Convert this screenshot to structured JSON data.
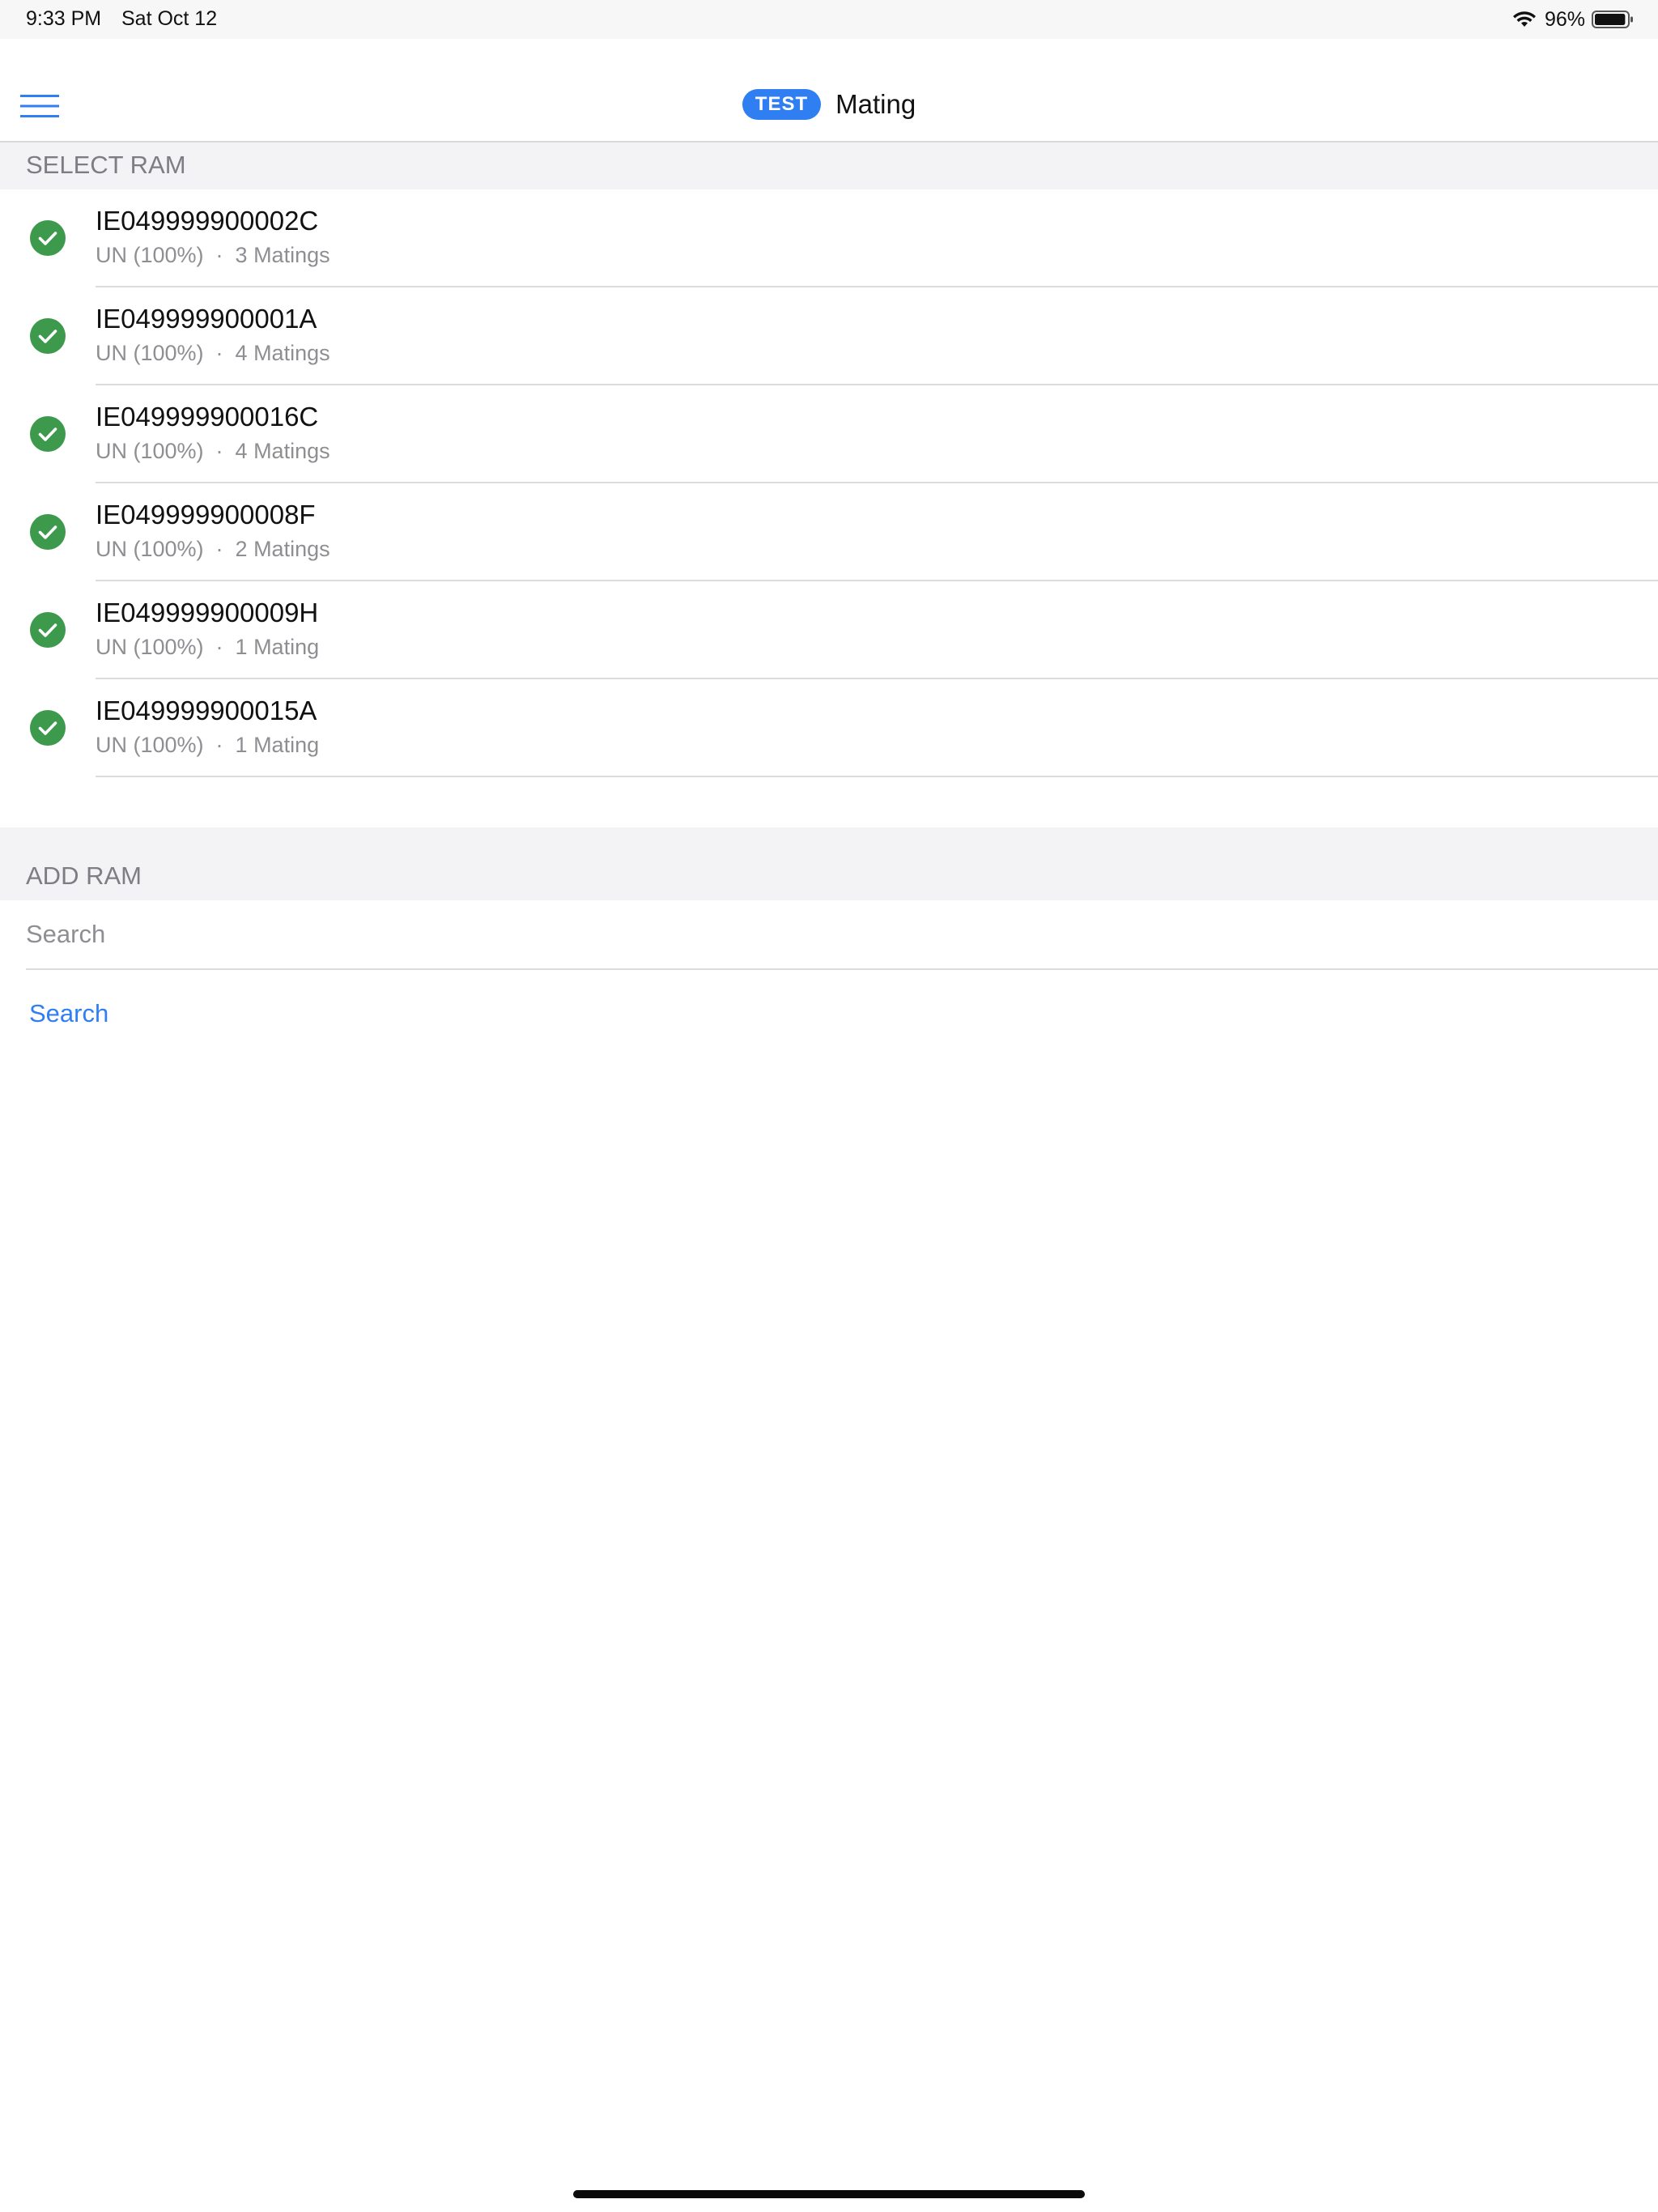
{
  "status_bar": {
    "time": "9:33 PM",
    "date": "Sat Oct 12",
    "battery_percent": "96%",
    "battery_level": 0.96,
    "icons": [
      "wifi-icon",
      "battery-icon"
    ]
  },
  "nav": {
    "badge": "TEST",
    "title": "Mating",
    "menu_icon": "hamburger-menu-icon"
  },
  "colors": {
    "accent": "#2f7ef2",
    "check_green": "#3d9a4c",
    "section_bg": "#f3f3f6",
    "secondary_text": "#8e8e93"
  },
  "select_section": {
    "header": "SELECT RAM",
    "separator": "·",
    "rams": [
      {
        "id": "IE049999900002C",
        "breed": "UN (100%)",
        "matings": "3 Matings",
        "selected": true
      },
      {
        "id": "IE049999900001A",
        "breed": "UN (100%)",
        "matings": "4 Matings",
        "selected": true
      },
      {
        "id": "IE049999900016C",
        "breed": "UN (100%)",
        "matings": "4 Matings",
        "selected": true
      },
      {
        "id": "IE049999900008F",
        "breed": "UN (100%)",
        "matings": "2 Matings",
        "selected": true
      },
      {
        "id": "IE049999900009H",
        "breed": "UN (100%)",
        "matings": "1 Mating",
        "selected": true
      },
      {
        "id": "IE049999900015A",
        "breed": "UN (100%)",
        "matings": "1 Mating",
        "selected": true
      }
    ]
  },
  "add_section": {
    "header": "ADD RAM",
    "search_placeholder": "Search",
    "search_value": "",
    "search_button": "Search"
  }
}
